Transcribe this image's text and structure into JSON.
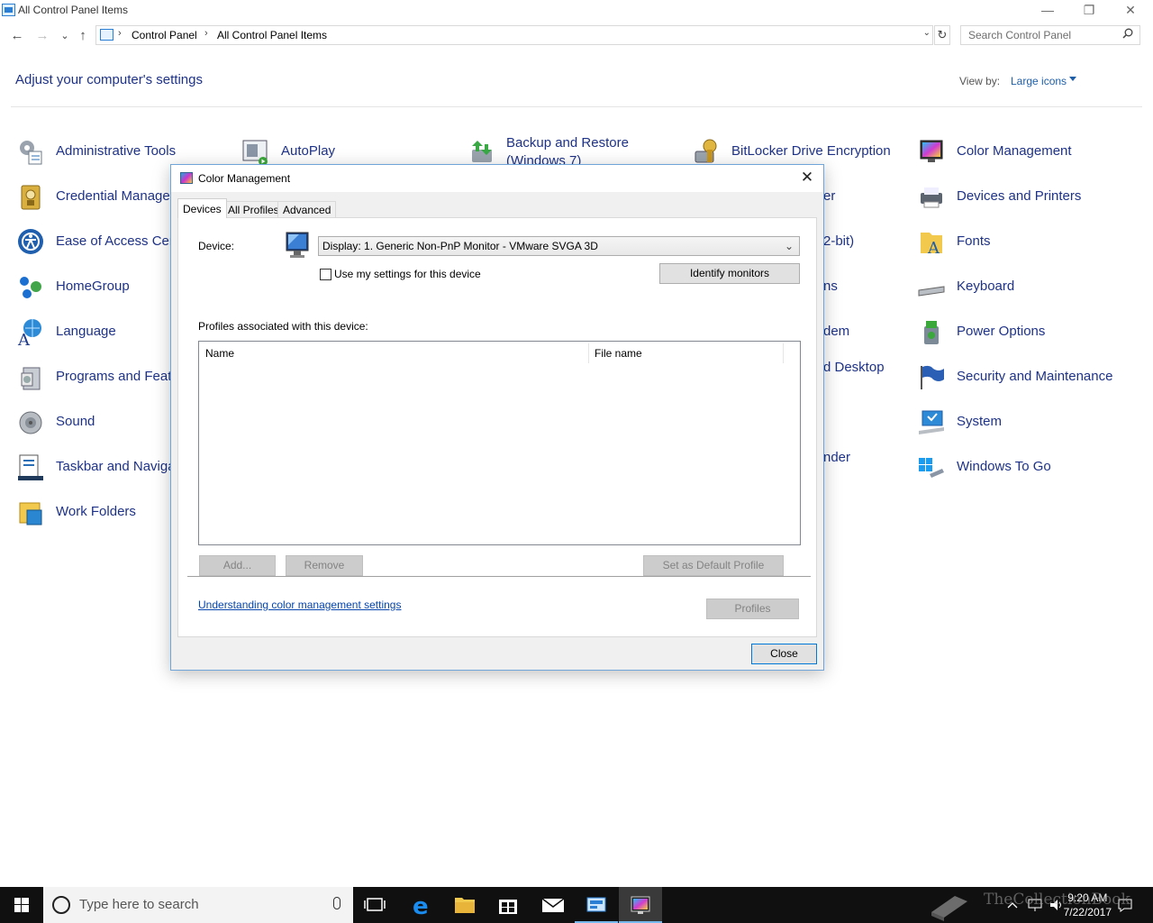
{
  "window": {
    "title": "All Control Panel Items",
    "minimize": "—",
    "restore": "❐",
    "close": "✕"
  },
  "nav": {
    "back": "←",
    "forward": "→",
    "recent": "⌄",
    "up": "↑",
    "breadcrumb": [
      "Control Panel",
      "All Control Panel Items"
    ],
    "separator": "›",
    "dropdown": "⌄",
    "refresh": "↻",
    "search_placeholder": "Search Control Panel"
  },
  "header": {
    "title": "Adjust your computer's settings",
    "view_by_label": "View by:",
    "view_by_value": "Large icons"
  },
  "items": [
    {
      "label": "Administrative Tools",
      "icon": "admin-tools-icon"
    },
    {
      "label": "AutoPlay",
      "icon": "autoplay-icon"
    },
    {
      "label": "Backup and Restore (Windows 7)",
      "icon": "backup-icon"
    },
    {
      "label": "BitLocker Drive Encryption",
      "icon": "bitlocker-icon"
    },
    {
      "label": "Color Management",
      "icon": "color-management-icon"
    },
    {
      "label": "Credential Manager",
      "icon": "credential-icon"
    },
    {
      "label": "er",
      "icon": ""
    },
    {
      "label": "Devices and Printers",
      "icon": "devices-printers-icon"
    },
    {
      "label": "Ease of Access Center",
      "icon": "ease-of-access-icon"
    },
    {
      "label": "2-bit)",
      "icon": ""
    },
    {
      "label": "Fonts",
      "icon": "fonts-icon"
    },
    {
      "label": "HomeGroup",
      "icon": "homegroup-icon"
    },
    {
      "label": "ns",
      "icon": ""
    },
    {
      "label": "Keyboard",
      "icon": "keyboard-icon"
    },
    {
      "label": "Language",
      "icon": "language-icon"
    },
    {
      "label": "dem",
      "icon": ""
    },
    {
      "label": "Power Options",
      "icon": "power-icon"
    },
    {
      "label": "Programs and Features",
      "icon": "programs-icon"
    },
    {
      "label": "d Desktop",
      "icon": ""
    },
    {
      "label": "Security and Maintenance",
      "icon": "security-flag-icon"
    },
    {
      "label": "Sound",
      "icon": "sound-icon"
    },
    {
      "label": "System",
      "icon": "system-icon"
    },
    {
      "label": "Taskbar and Navigation",
      "icon": "taskbar-icon"
    },
    {
      "label": "nder",
      "icon": ""
    },
    {
      "label": "Windows To Go",
      "icon": "windows-to-go-icon"
    },
    {
      "label": "Work Folders",
      "icon": "work-folders-icon"
    }
  ],
  "dialog": {
    "title": "Color Management",
    "close": "✕",
    "tabs": [
      "Devices",
      "All Profiles",
      "Advanced"
    ],
    "device_label": "Device:",
    "device_value": "Display: 1. Generic Non-PnP Monitor - VMware SVGA 3D",
    "use_settings_label": "Use my settings for this device",
    "identify_button": "Identify monitors",
    "profiles_label": "Profiles associated with this device:",
    "columns": [
      "Name",
      "File name"
    ],
    "add_button": "Add...",
    "remove_button": "Remove",
    "set_default_button": "Set as Default Profile",
    "help_link": "Understanding color management settings",
    "profiles_button": "Profiles",
    "close_button": "Close"
  },
  "taskbar": {
    "search_text": "Type here to search",
    "time": "9:20 AM",
    "date": "7/22/2017",
    "watermark": "TheCollectionBook",
    "accent": "#76b9ed"
  }
}
